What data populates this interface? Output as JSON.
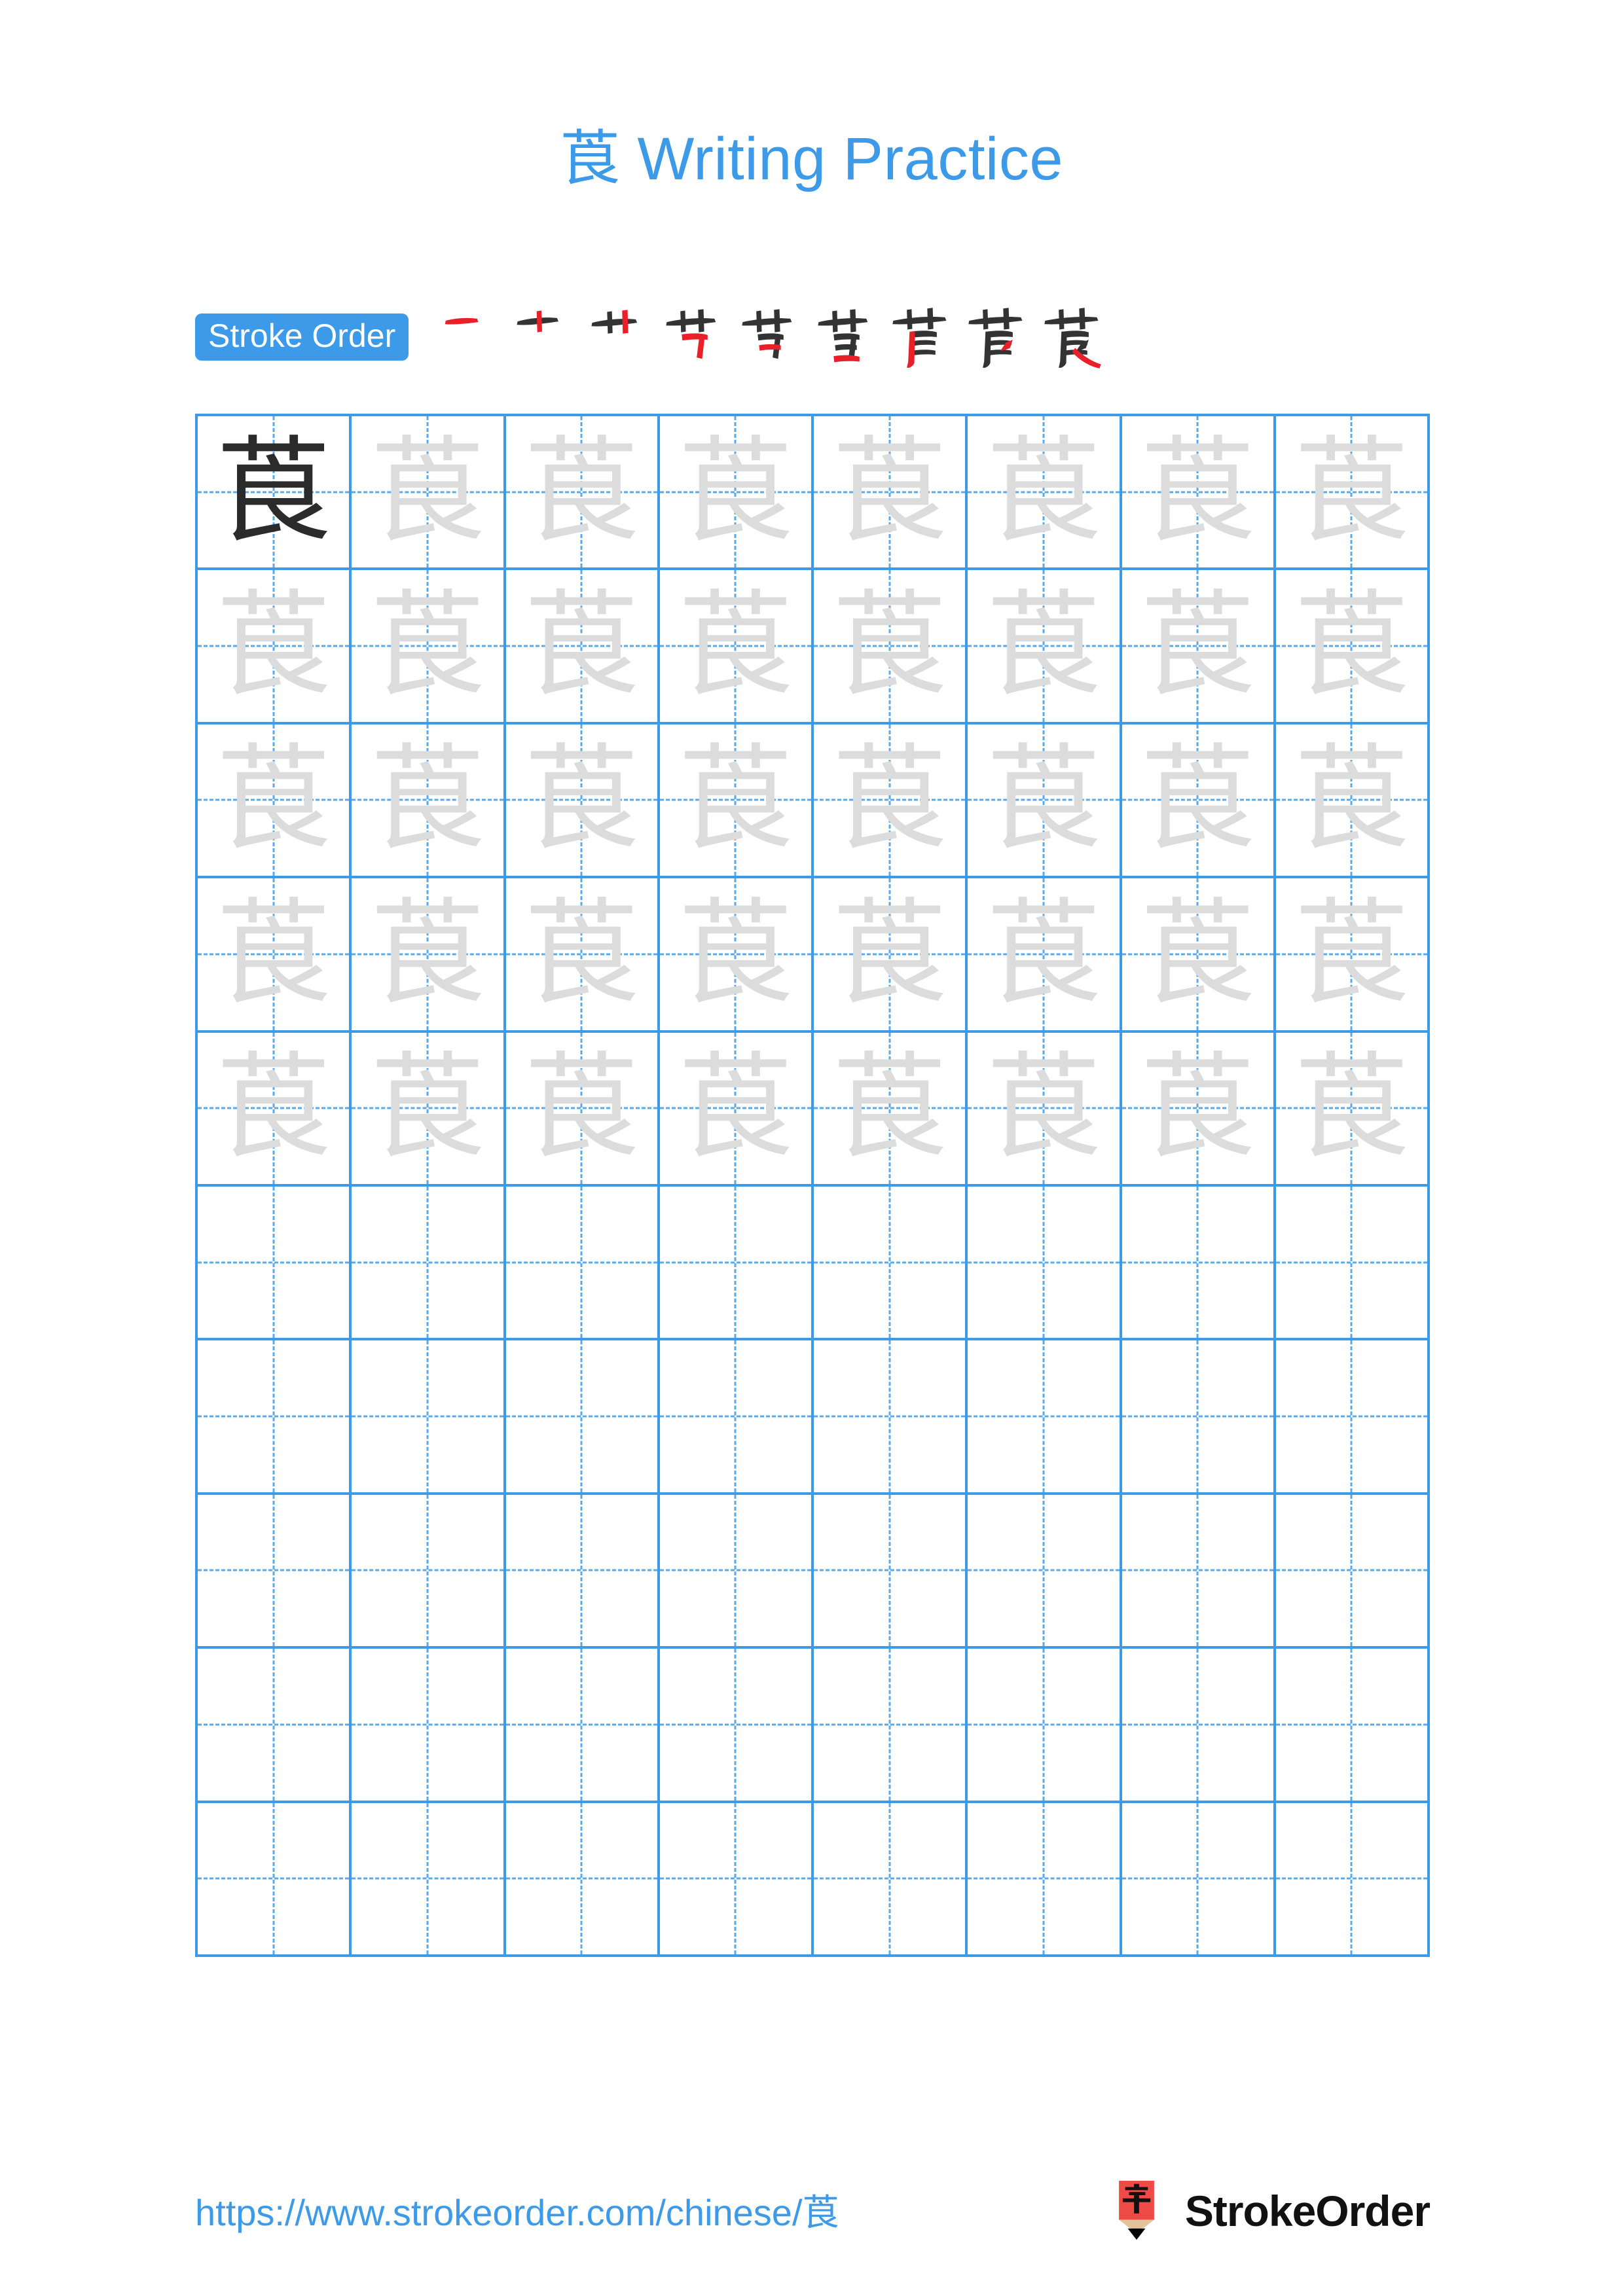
{
  "page": {
    "background_color": "#ffffff",
    "accent_color": "#3d9ae8",
    "model_glyph_color": "#2b2b2b",
    "trace_glyph_color": "#dcdcdc",
    "new_stroke_color": "#e8202a"
  },
  "header": {
    "character": "莨",
    "title_suffix": " Writing Practice",
    "title_full": "莨 Writing Practice"
  },
  "stroke_order": {
    "badge_label": "Stroke Order",
    "total_strokes": 9,
    "steps": [
      {
        "index": 1,
        "glyph": "一",
        "new_stroke_color": "#e8202a"
      },
      {
        "index": 2,
        "glyph": "十",
        "new_stroke_color": "#e8202a"
      },
      {
        "index": 3,
        "glyph": "卅",
        "new_stroke_color": "#e8202a"
      },
      {
        "index": 4,
        "glyph": "艿",
        "new_stroke_color": "#e8202a"
      },
      {
        "index": 5,
        "glyph": "芎",
        "new_stroke_color": "#e8202a"
      },
      {
        "index": 6,
        "glyph": "苣",
        "new_stroke_color": "#e8202a"
      },
      {
        "index": 7,
        "glyph": "苣",
        "new_stroke_color": "#e8202a"
      },
      {
        "index": 8,
        "glyph": "莨",
        "new_stroke_color": "#e8202a"
      },
      {
        "index": 9,
        "glyph": "莨",
        "new_stroke_color": "#e8202a"
      }
    ]
  },
  "practice_grid": {
    "columns": 8,
    "rows": 10,
    "filled_rows": 5,
    "empty_rows": 5,
    "model_cell": {
      "row": 1,
      "column": 1,
      "glyph": "莨"
    },
    "trace_glyph": "莨",
    "guide_style": "dashed-crosshair",
    "border_color": "#3d9ae8",
    "guide_color": "#5aa9ea"
  },
  "footer": {
    "url": "https://www.strokeorder.com/chinese/莨",
    "brand_name": "StrokeOrder",
    "logo_character": "字",
    "logo_body_color": "#ee4b46",
    "logo_wood_color": "#e3c49a",
    "logo_tip_color": "#000000"
  }
}
